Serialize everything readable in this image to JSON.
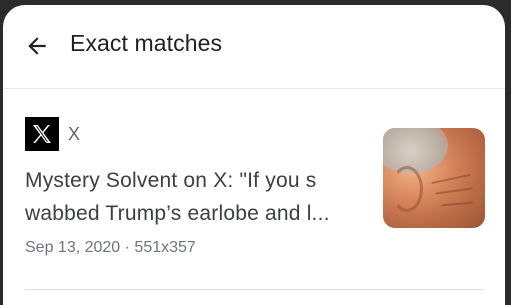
{
  "header": {
    "title": "Exact matches",
    "back_icon": "arrow-back-icon"
  },
  "result": {
    "source_icon": "x-logo-icon",
    "source_name": "X",
    "title_line1": "Mystery Solvent on X: \"If you s",
    "title_line2": "wabbed Trump’s earlobe and l...",
    "meta": "Sep 13, 2020 · 551x357",
    "thumbnail": "close-up photo of a man's ear and temple"
  },
  "colors": {
    "background": "#ffffff",
    "frame": "#2b2b2b",
    "title_text": "#202124",
    "secondary_text": "#70757a"
  }
}
